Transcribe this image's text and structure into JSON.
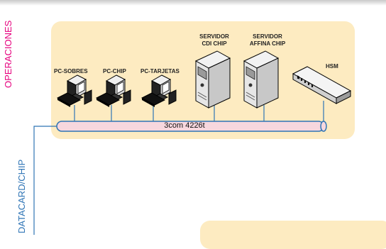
{
  "side_labels": {
    "operaciones": "OPERACIONES",
    "datacard": "DATACARD/CHIP"
  },
  "devices": {
    "pc_sobres": "PC-SOBRES",
    "pc_chip": "PC-CHIP",
    "pc_tarjetas": "PC-TARJETAS",
    "servidor_cdi_line1": "SERVIDOR",
    "servidor_cdi_line2": "CDI CHIP",
    "servidor_affina_line1": "SERVIDOR",
    "servidor_affina_line2": "AFFINA CHIP",
    "hsm": "HSM"
  },
  "network": {
    "switch_label": "3com 4226t"
  },
  "colors": {
    "panel": "#fdebc1",
    "bus_fill": "#f7d7de",
    "line": "#2e74b5",
    "operaciones": "#e6007e"
  }
}
